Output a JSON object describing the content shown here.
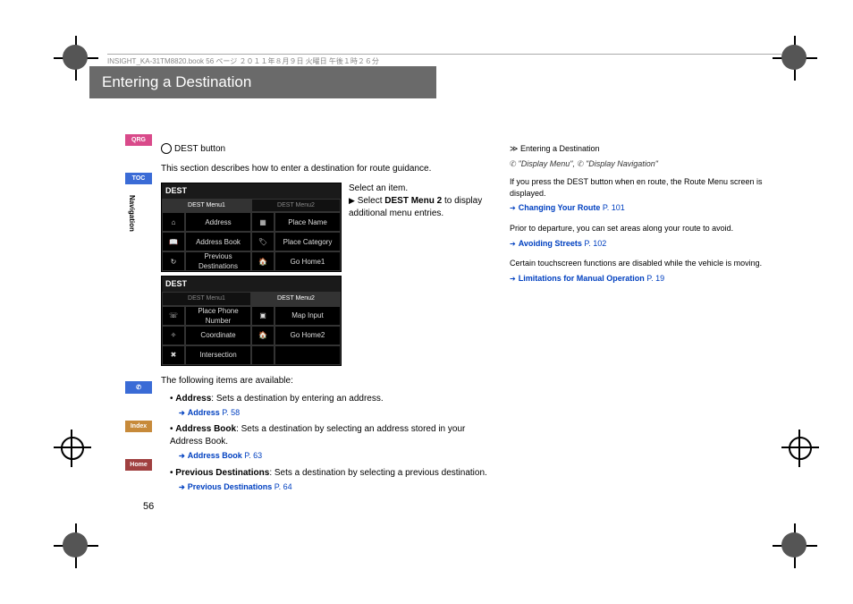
{
  "header": {
    "filestamp": "INSIGHT_KA-31TM8820.book   56 ページ   ２０１１年８月９日   火曜日   午後１時２６分"
  },
  "title": "Entering a Destination",
  "sideTabs": {
    "qrg": "QRG",
    "toc": "TOC",
    "voice": "",
    "index": "Index",
    "home": "Home"
  },
  "sideLabel": "Navigation",
  "destButton": "DEST button",
  "intro": "This section describes how to enter a destination for route guidance.",
  "instruction": {
    "line1": "Select an item.",
    "line2a": "Select ",
    "line2b": "DEST Menu 2",
    "line2c": " to display additional menu entries."
  },
  "screen1": {
    "title": "DEST",
    "tab1": "DEST Menu1",
    "tab2": "DEST Menu2",
    "r1c1": "Address",
    "r1c2": "Place Name",
    "r2c1": "Address Book",
    "r2c2": "Place Category",
    "r3c1": "Previous Destinations",
    "r3c2": "Go Home1"
  },
  "screen2": {
    "title": "DEST",
    "tab1": "DEST Menu1",
    "tab2": "DEST Menu2",
    "r1c1": "Place Phone Number",
    "r1c2": "Map Input",
    "r2c1": "Coordinate",
    "r2c2": "Go Home2",
    "r3c1": "Intersection"
  },
  "below": {
    "avail": "The following items are available:",
    "b1a": "Address",
    "b1b": ": Sets a destination by entering an address.",
    "l1": "Address",
    "l1p": "P. 58",
    "b2a": "Address Book",
    "b2b": ": Sets a destination by selecting an address stored in your Address Book.",
    "l2": "Address Book",
    "l2p": "P. 63",
    "b3a": "Previous Destinations",
    "b3b": ": Sets a destination by selecting a previous destination.",
    "l3": "Previous Destinations",
    "l3p": "P. 64"
  },
  "rightcol": {
    "title": "Entering a Destination",
    "voice1": "\"Display Menu\"",
    "voice2": "\"Display Navigation\"",
    "p1": "If you press the DEST button when en route, the Route Menu screen is displayed.",
    "l1": "Changing Your Route",
    "l1p": "P. 101",
    "p2": "Prior to departure, you can set areas along your route to avoid.",
    "l2": "Avoiding Streets",
    "l2p": "P. 102",
    "p3": "Certain touchscreen functions are disabled while the vehicle is moving.",
    "l3": "Limitations for Manual Operation",
    "l3p": "P. 19"
  },
  "pageNumber": "56"
}
